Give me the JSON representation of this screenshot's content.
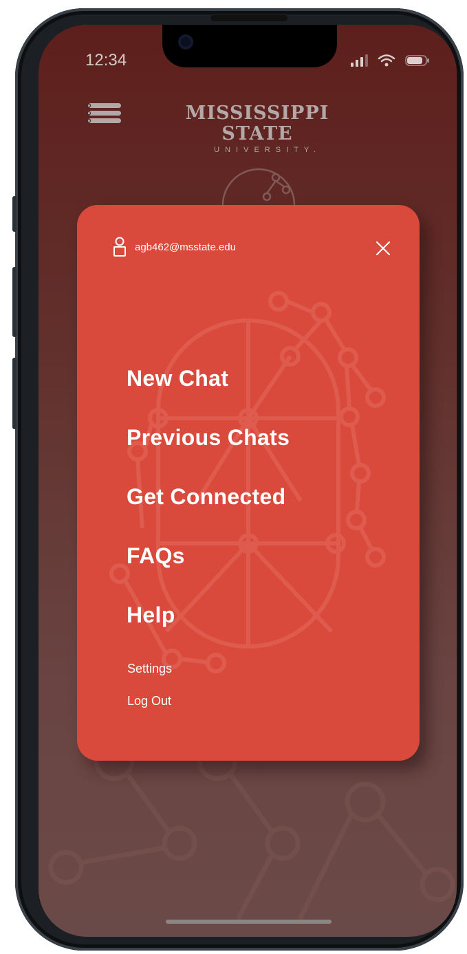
{
  "status_bar": {
    "time": "12:34",
    "signal_icon": "signal-bars-icon",
    "wifi_icon": "wifi-icon",
    "battery_icon": "battery-icon"
  },
  "header": {
    "menu_icon": "menu-icon",
    "brand_name": "MISSISSIPPI STATE",
    "brand_sub": "UNIVERSITY."
  },
  "menu_panel": {
    "user_icon": "user-icon",
    "user_email": "agb462@msstate.edu",
    "close_icon": "close-icon",
    "primary_items": [
      {
        "label": "New Chat"
      },
      {
        "label": "Previous Chats"
      },
      {
        "label": "Get Connected"
      },
      {
        "label": "FAQs"
      },
      {
        "label": "Help"
      }
    ],
    "secondary_items": [
      {
        "label": "Settings"
      },
      {
        "label": "Log Out"
      }
    ]
  },
  "colors": {
    "panel": "#da4a3c",
    "screen_top": "#5e1f1c",
    "screen_bottom": "#6a4a48",
    "text": "#ffffff"
  }
}
